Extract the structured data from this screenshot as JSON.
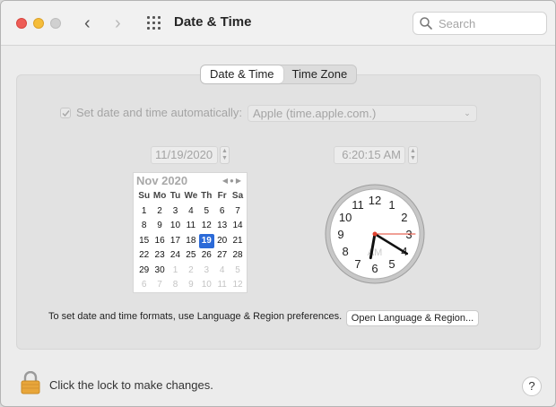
{
  "window": {
    "title": "Date & Time",
    "traffic_lights": [
      "close",
      "minimize",
      "zoom"
    ],
    "nav": {
      "back_icon": "chevron-left-icon",
      "forward_icon": "chevron-right-icon",
      "grid_icon": "show-all-grid-icon"
    },
    "search": {
      "placeholder": "Search"
    }
  },
  "tabs": [
    {
      "label": "Date & Time",
      "selected": true
    },
    {
      "label": "Time Zone",
      "selected": false
    }
  ],
  "auto_time": {
    "label": "Set date and time automatically:",
    "checked": true,
    "server": "Apple (time.apple.com.)"
  },
  "date": {
    "value": "11/19/2020"
  },
  "time": {
    "value": "6:20:15 AM"
  },
  "calendar": {
    "month_label": "Nov 2020",
    "weekdays": [
      "Su",
      "Mo",
      "Tu",
      "We",
      "Th",
      "Fr",
      "Sa"
    ],
    "weeks": [
      [
        "1",
        "2",
        "3",
        "4",
        "5",
        "6",
        "7"
      ],
      [
        "8",
        "9",
        "10",
        "11",
        "12",
        "13",
        "14"
      ],
      [
        "15",
        "16",
        "17",
        "18",
        "19",
        "20",
        "21"
      ],
      [
        "22",
        "23",
        "24",
        "25",
        "26",
        "27",
        "28"
      ],
      [
        "29",
        "30",
        "1",
        "2",
        "3",
        "4",
        "5"
      ],
      [
        "6",
        "7",
        "8",
        "9",
        "10",
        "11",
        "12"
      ]
    ],
    "selected_day": "19"
  },
  "clock": {
    "numbers": [
      "12",
      "1",
      "2",
      "3",
      "4",
      "5",
      "6",
      "7",
      "8",
      "9",
      "10",
      "11"
    ],
    "ampm": "AM",
    "hour": 6,
    "minute": 20,
    "second": 15,
    "second_hand_color": "#e0402e"
  },
  "footer": {
    "formats_text": "To set date and time formats, use Language & Region preferences.",
    "lang_button": "Open Language & Region...",
    "lock_text": "Click the lock to make changes.",
    "help_label": "?"
  }
}
